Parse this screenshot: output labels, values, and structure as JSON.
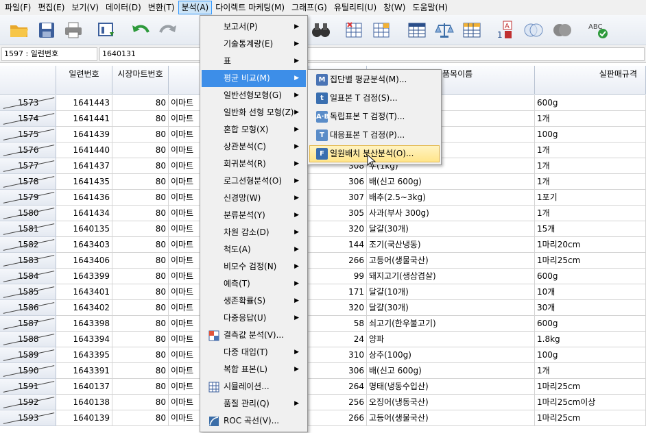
{
  "menubar": {
    "items": [
      {
        "label": "파일(F)",
        "active": false
      },
      {
        "label": "편집(E)",
        "active": false
      },
      {
        "label": "보기(V)",
        "active": false
      },
      {
        "label": "데이터(D)",
        "active": false
      },
      {
        "label": "변환(T)",
        "active": false
      },
      {
        "label": "분석(A)",
        "active": true
      },
      {
        "label": "다이렉트 마케팅(M)",
        "active": false
      },
      {
        "label": "그래프(G)",
        "active": false
      },
      {
        "label": "유틸리티(U)",
        "active": false
      },
      {
        "label": "창(W)",
        "active": false
      },
      {
        "label": "도움말(H)",
        "active": false
      }
    ]
  },
  "toolbar": {
    "icons": [
      "open-folder-icon",
      "save-icon",
      "print-icon",
      "dialog-recall-icon",
      "undo-icon",
      "redo-icon",
      "find-binoculars-icon",
      "insert-cases-icon",
      "insert-variable-icon",
      "split-file-icon",
      "weight-cases-icon",
      "select-cases-icon",
      "value-labels-icon",
      "use-sets-icon",
      "show-all-icon",
      "spellcheck-icon"
    ]
  },
  "cellbar": {
    "cell_ref": "1597 : 일련번호",
    "cell_value": "1640131"
  },
  "grid": {
    "headers": [
      "일련번호",
      "시장마트번호",
      "",
      "",
      "품목이름",
      "실판매규격"
    ],
    "rows": [
      {
        "n": "1573",
        "id": "1641443",
        "m": "80",
        "mart": "이마트",
        "code": "",
        "item": "",
        "spec": "600g"
      },
      {
        "n": "1574",
        "id": "1641441",
        "m": "80",
        "mart": "이마트",
        "code": "",
        "item": "",
        "spec": "1개"
      },
      {
        "n": "1575",
        "id": "1641439",
        "m": "80",
        "mart": "이마트",
        "code": "",
        "item": "",
        "spec": "100g"
      },
      {
        "n": "1576",
        "id": "1641440",
        "m": "80",
        "mart": "이마트",
        "code": "",
        "item": "",
        "spec": "1개"
      },
      {
        "n": "1577",
        "id": "1641437",
        "m": "80",
        "mart": "이마트",
        "code": "308",
        "item": "무(1kg)",
        "spec": "1개"
      },
      {
        "n": "1578",
        "id": "1641435",
        "m": "80",
        "mart": "이마트",
        "code": "306",
        "item": "배(신고 600g)",
        "spec": "1개"
      },
      {
        "n": "1579",
        "id": "1641436",
        "m": "80",
        "mart": "이마트",
        "code": "307",
        "item": "배추(2.5~3kg)",
        "spec": "1포기"
      },
      {
        "n": "1580",
        "id": "1641434",
        "m": "80",
        "mart": "이마트",
        "code": "305",
        "item": "사과(부사 300g)",
        "spec": "1개"
      },
      {
        "n": "1581",
        "id": "1640135",
        "m": "80",
        "mart": "이마트",
        "code": "320",
        "item": "달걀(30개)",
        "spec": "15개"
      },
      {
        "n": "1582",
        "id": "1643403",
        "m": "80",
        "mart": "이마트",
        "code": "144",
        "item": "조기(국산냉동)",
        "spec": "1마리20cm"
      },
      {
        "n": "1583",
        "id": "1643406",
        "m": "80",
        "mart": "이마트",
        "code": "266",
        "item": "고등어(생물국산)",
        "spec": "1마리25cm"
      },
      {
        "n": "1584",
        "id": "1643399",
        "m": "80",
        "mart": "이마트",
        "code": "99",
        "item": "돼지고기(생삼겹살)",
        "spec": "600g"
      },
      {
        "n": "1585",
        "id": "1643401",
        "m": "80",
        "mart": "이마트",
        "code": "171",
        "item": "달걀(10개)",
        "spec": "10개"
      },
      {
        "n": "1586",
        "id": "1643402",
        "m": "80",
        "mart": "이마트",
        "code": "320",
        "item": "달걀(30개)",
        "spec": "30개"
      },
      {
        "n": "1587",
        "id": "1643398",
        "m": "80",
        "mart": "이마트",
        "code": "58",
        "item": "쇠고기(한우불고기)",
        "spec": "600g"
      },
      {
        "n": "1588",
        "id": "1643394",
        "m": "80",
        "mart": "이마트",
        "code": "24",
        "item": "양파",
        "spec": "1.8kg"
      },
      {
        "n": "1589",
        "id": "1643395",
        "m": "80",
        "mart": "이마트",
        "code": "310",
        "item": "상추(100g)",
        "spec": "100g"
      },
      {
        "n": "1590",
        "id": "1643391",
        "m": "80",
        "mart": "이마트",
        "code": "306",
        "item": "배(신고 600g)",
        "spec": "1개"
      },
      {
        "n": "1591",
        "id": "1640137",
        "m": "80",
        "mart": "이마트",
        "code": "264",
        "item": "명태(냉동수입산)",
        "spec": "1마리25cm"
      },
      {
        "n": "1592",
        "id": "1640138",
        "m": "80",
        "mart": "이마트",
        "code": "256",
        "item": "오징어(냉동국산)",
        "spec": "1마리25cm이상"
      },
      {
        "n": "1593",
        "id": "1640139",
        "m": "80",
        "mart": "이마트",
        "code": "266",
        "item": "고등어(생물국산)",
        "spec": "1마리25cm"
      }
    ]
  },
  "menu": {
    "items": [
      {
        "label": "보고서(P)",
        "sub": true,
        "icon": ""
      },
      {
        "label": "기술통계량(E)",
        "sub": true,
        "icon": ""
      },
      {
        "label": "표",
        "sub": true,
        "icon": ""
      },
      {
        "label": "평균 비교(M)",
        "sub": true,
        "icon": "",
        "hl": true
      },
      {
        "label": "일반선형모형(G)",
        "sub": true,
        "icon": ""
      },
      {
        "label": "일반화 선형 모형(Z)",
        "sub": true,
        "icon": ""
      },
      {
        "label": "혼합 모형(X)",
        "sub": true,
        "icon": ""
      },
      {
        "label": "상관분석(C)",
        "sub": true,
        "icon": ""
      },
      {
        "label": "회귀분석(R)",
        "sub": true,
        "icon": ""
      },
      {
        "label": "로그선형분석(O)",
        "sub": true,
        "icon": ""
      },
      {
        "label": "신경망(W)",
        "sub": true,
        "icon": ""
      },
      {
        "label": "분류분석(Y)",
        "sub": true,
        "icon": ""
      },
      {
        "label": "차원 감소(D)",
        "sub": true,
        "icon": ""
      },
      {
        "label": "척도(A)",
        "sub": true,
        "icon": ""
      },
      {
        "label": "비모수 검정(N)",
        "sub": true,
        "icon": ""
      },
      {
        "label": "예측(T)",
        "sub": true,
        "icon": ""
      },
      {
        "label": "생존확률(S)",
        "sub": true,
        "icon": ""
      },
      {
        "label": "다중응답(U)",
        "sub": true,
        "icon": ""
      },
      {
        "label": "결측값 분석(V)...",
        "sub": false,
        "icon": "missing-values-icon"
      },
      {
        "label": "다중 대입(T)",
        "sub": true,
        "icon": ""
      },
      {
        "label": "복합 표본(L)",
        "sub": true,
        "icon": ""
      },
      {
        "label": "시뮬레이션...",
        "sub": false,
        "icon": "simulation-icon"
      },
      {
        "label": "품질 관리(Q)",
        "sub": true,
        "icon": ""
      },
      {
        "label": "ROC 곡선(V)...",
        "sub": false,
        "icon": "roc-curve-icon"
      }
    ]
  },
  "submenu": {
    "items": [
      {
        "label": "집단별 평균분석(M)...",
        "icon_text": "M",
        "icon_color": "#4a74b5"
      },
      {
        "label": "일표본 T 검정(S)...",
        "icon_text": "t",
        "icon_color": "#3a6fb0"
      },
      {
        "label": "독립표본 T 검정(T)...",
        "icon_text": "A·B",
        "icon_color": "#5a8cc8"
      },
      {
        "label": "대응표본 T 검정(P)...",
        "icon_text": "T",
        "icon_color": "#5a8cc8"
      },
      {
        "label": "일원배치 분산분석(O)...",
        "icon_text": "F",
        "icon_color": "#3a6fb0",
        "hl": true
      }
    ]
  },
  "colors": {
    "menu_highlight": "#3d8ee8",
    "submenu_highlight": "#ffe488"
  }
}
